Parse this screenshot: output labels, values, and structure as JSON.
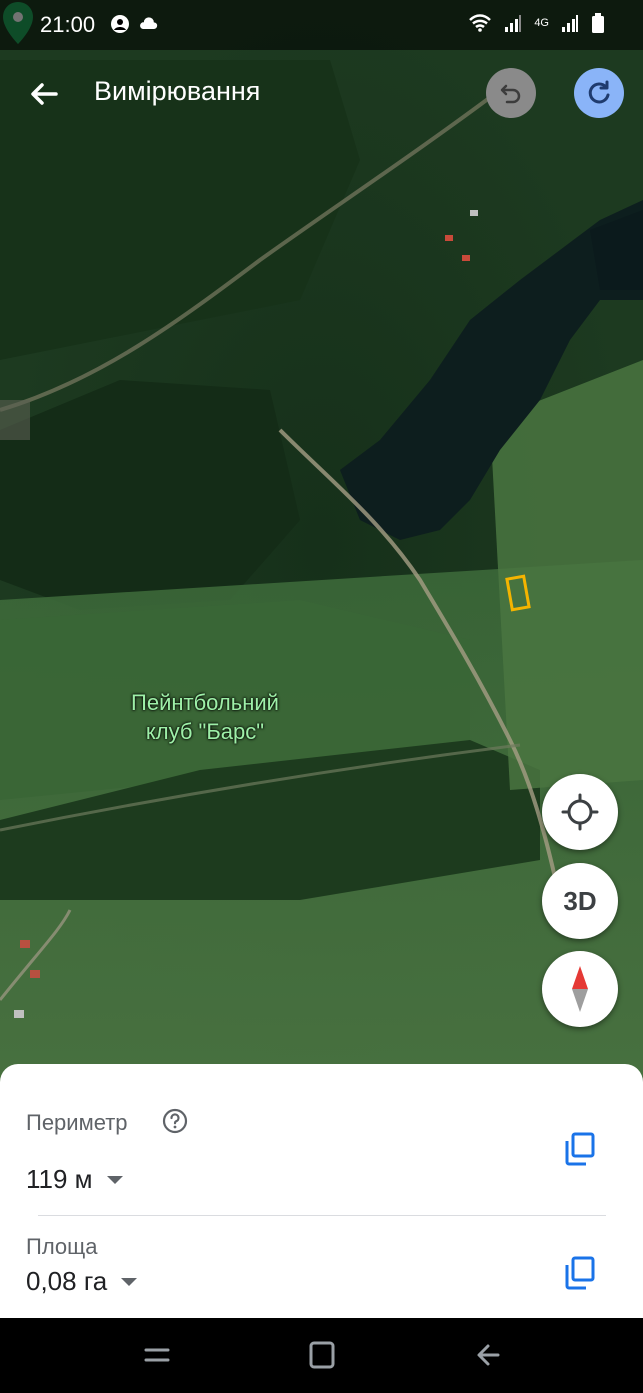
{
  "status_bar": {
    "time": "21:00",
    "network": "4G",
    "icons": [
      "account-circle-icon",
      "cloud-icon",
      "wifi-icon",
      "signal-icon",
      "battery-icon"
    ]
  },
  "app_bar": {
    "title": "Вимірювання",
    "back_icon": "arrow-back-icon",
    "undo_icon": "undo-icon",
    "redo_icon": "redo-icon"
  },
  "map": {
    "poi_label_line1": "Пейнтбольний",
    "poi_label_line2": "клуб \"Барс\"",
    "poi_color": "#9ef0a8",
    "measure_color": "#f5b400"
  },
  "fabs": {
    "location_icon": "my-location-icon",
    "threed_label": "3D",
    "compass_icon": "compass-icon"
  },
  "measurement": {
    "perimeter_label": "Периметр",
    "perimeter_value": "119 м",
    "area_label": "Площа",
    "area_value": "0,08 га",
    "accent": "#1a73e8"
  },
  "nav_bar": {
    "icons": [
      "recents-icon",
      "home-icon",
      "back-icon"
    ]
  }
}
